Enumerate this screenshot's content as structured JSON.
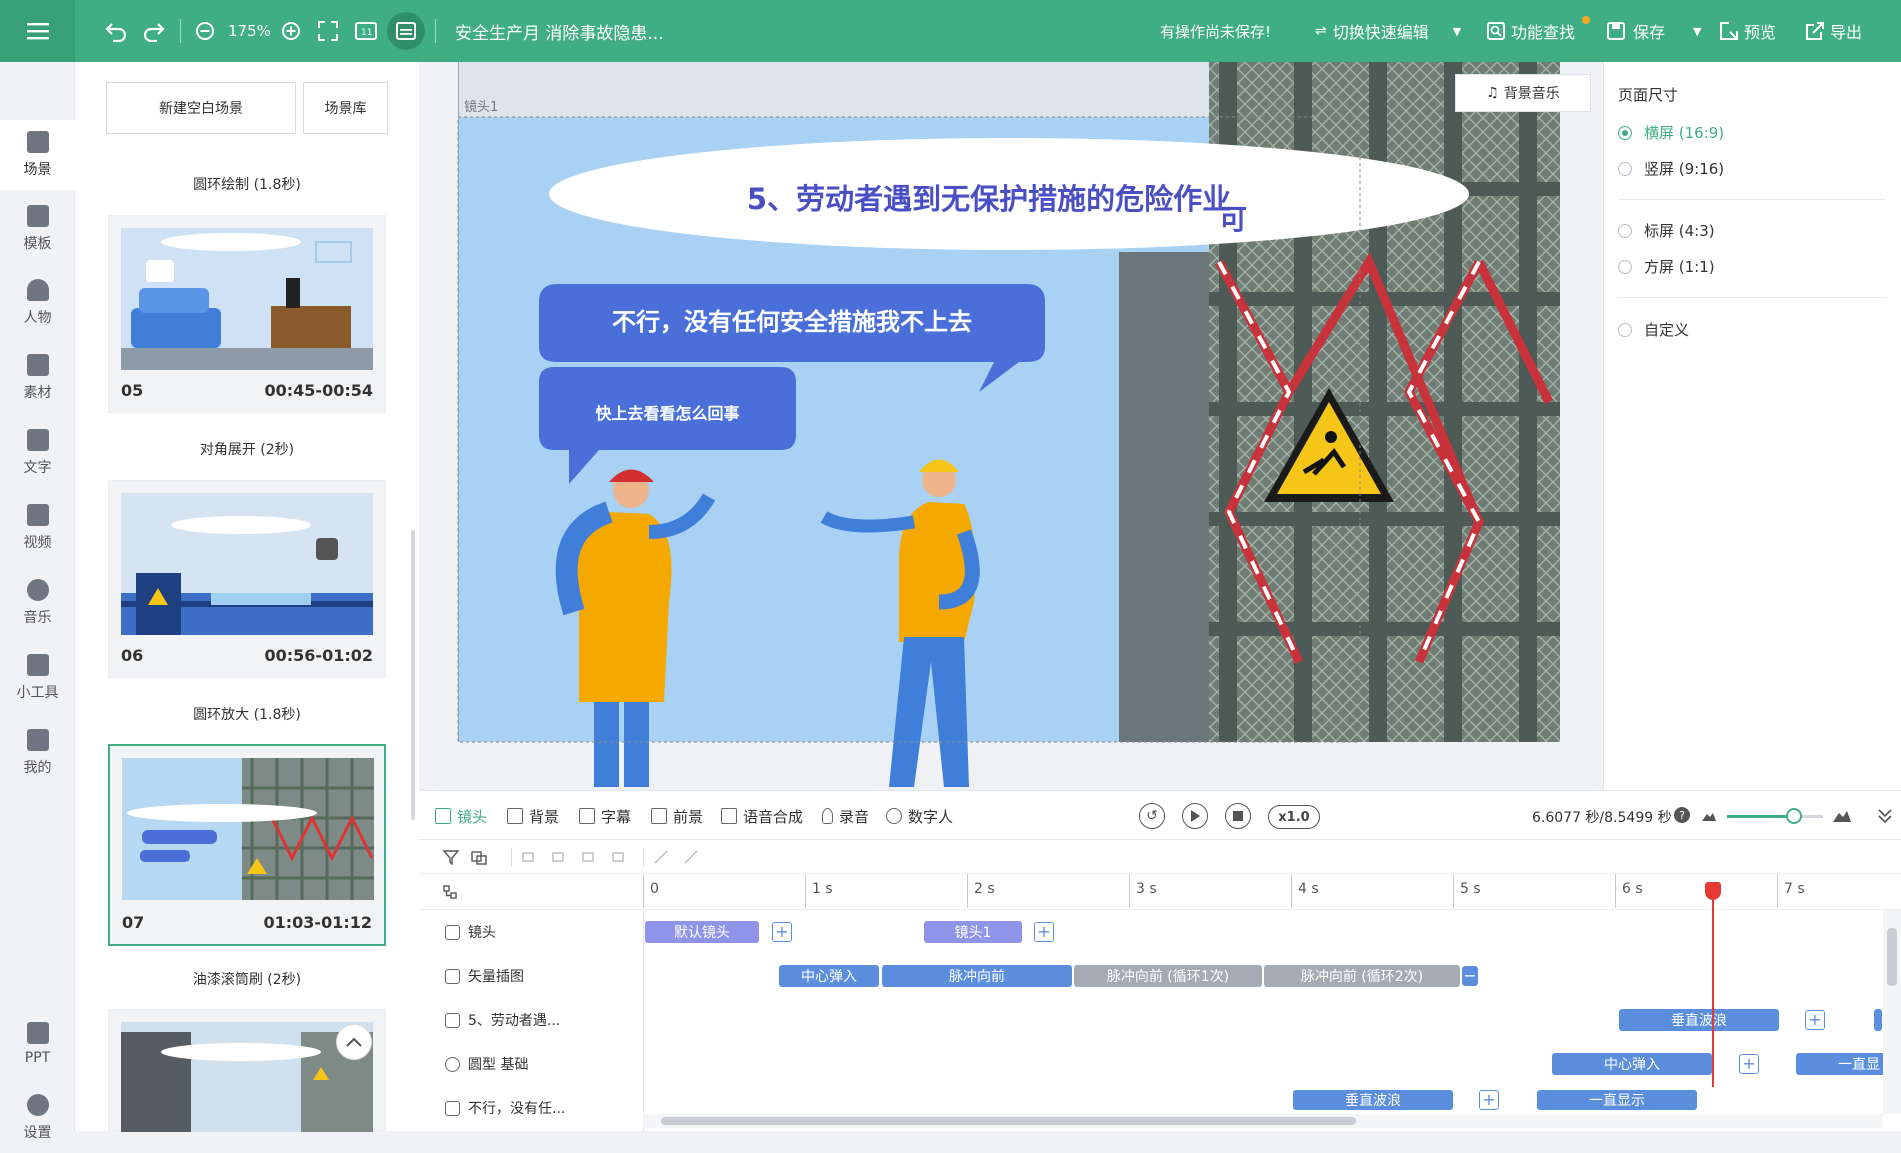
{
  "topbar": {
    "zoom": "175%",
    "doc_title": "安全生产月 消除事故隐患...",
    "unsaved_note": "有操作尚未保存!",
    "switch_label": "切换快速编辑",
    "find_label": "功能查找",
    "save_label": "保存",
    "preview_label": "预览",
    "export_label": "导出"
  },
  "nav": [
    {
      "label": "场景",
      "icon": "scene-icon"
    },
    {
      "label": "模板",
      "icon": "template-icon"
    },
    {
      "label": "人物",
      "icon": "person-icon"
    },
    {
      "label": "素材",
      "icon": "material-icon"
    },
    {
      "label": "文字",
      "icon": "text-icon"
    },
    {
      "label": "视频",
      "icon": "video-icon"
    },
    {
      "label": "音乐",
      "icon": "music-icon"
    },
    {
      "label": "小工具",
      "icon": "toolbox-icon"
    },
    {
      "label": "我的",
      "icon": "upload-icon"
    },
    {
      "label": "PPT",
      "icon": "ppt-icon"
    },
    {
      "label": "设置",
      "icon": "settings-icon"
    }
  ],
  "scene_panel": {
    "new_blank": "新建空白场景",
    "library": "场景库",
    "transitions": [
      "圆环绘制 (1.8秒)",
      "对角展开 (2秒)",
      "圆环放大 (1.8秒)",
      "油漆滚筒刷 (2秒)"
    ],
    "cards": [
      {
        "num": "05",
        "time": "00:45-00:54"
      },
      {
        "num": "06",
        "time": "00:56-01:02"
      },
      {
        "num": "07",
        "time": "01:03-01:12"
      }
    ]
  },
  "canvas": {
    "lens_label": "镜头1",
    "bg_music": "背景音乐",
    "headline": "5、劳动者遇到无保护措施的危险作业",
    "headline_tail": "可",
    "bubble_main": "不行，没有任何安全措施我不上去",
    "bubble_small": "快上去看看怎么回事"
  },
  "page_size": {
    "title": "页面尺寸",
    "options": [
      {
        "label": "横屏 (16:9)",
        "selected": true
      },
      {
        "label": "竖屏 (9:16)",
        "selected": false
      },
      {
        "label": "标屏 (4:3)",
        "selected": false
      },
      {
        "label": "方屏 (1:1)",
        "selected": false
      },
      {
        "label": "自定义",
        "selected": false
      }
    ]
  },
  "timeline": {
    "tabs": [
      "镜头",
      "背景",
      "字幕",
      "前景",
      "语音合成",
      "录音",
      "数字人"
    ],
    "speed": "x1.0",
    "time_readout": "6.6077 秒/8.5499 秒",
    "playhead_seconds": 6.6077,
    "duration_seconds": 8.5499,
    "ticks": [
      "0",
      "1 s",
      "2 s",
      "3 s",
      "4 s",
      "5 s",
      "6 s",
      "7 s"
    ],
    "tracks": [
      {
        "label": "镜头"
      },
      {
        "label": "矢量插图"
      },
      {
        "label": "5、劳动者遇..."
      },
      {
        "label": "圆型 基础"
      },
      {
        "label": "不行，没有任..."
      }
    ],
    "clips": {
      "default_lens": "默认镜头",
      "lens1": "镜头1",
      "center_pop": "中心弹入",
      "pulse_fwd": "脉冲向前",
      "pulse_loop1": "脉冲向前 (循环1次)",
      "pulse_loop2": "脉冲向前 (循环2次)",
      "vertical_wave": "垂直波浪",
      "center_pop2": "中心弹入",
      "always_show_cut": "一直显",
      "vertical_wave2": "垂直波浪",
      "always_show": "一直显示"
    }
  }
}
